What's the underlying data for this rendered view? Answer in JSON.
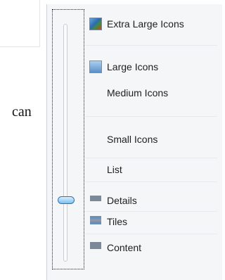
{
  "side_text": "can",
  "view_menu": {
    "items": [
      {
        "label": "Extra Large Icons",
        "icon": "extra-large-icons-icon"
      },
      {
        "label": "Large Icons",
        "icon": "large-icons-icon"
      },
      {
        "label": "Medium Icons",
        "icon": "medium-icons-icon"
      },
      {
        "label": "Small Icons",
        "icon": "small-icons-icon"
      },
      {
        "label": "List",
        "icon": "list-icon"
      },
      {
        "label": "Details",
        "icon": "details-icon"
      },
      {
        "label": "Tiles",
        "icon": "tiles-icon"
      },
      {
        "label": "Content",
        "icon": "content-icon"
      }
    ],
    "selected": "Details"
  },
  "colors": {
    "menu_background": "#f5f6f8",
    "thumb_fill": "#7dc0ef",
    "thumb_border": "#2c75b3"
  }
}
